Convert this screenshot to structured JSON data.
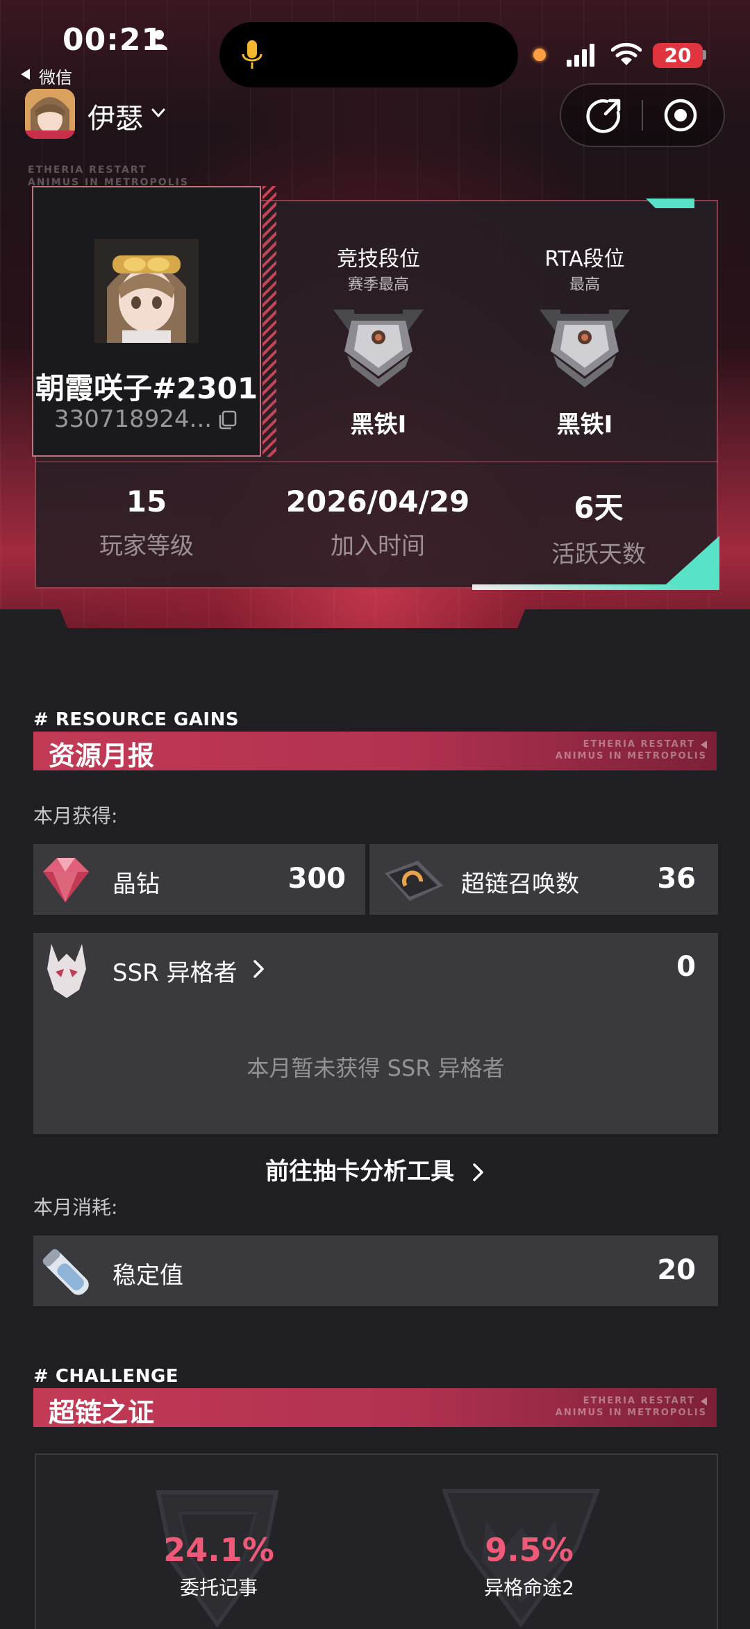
{
  "status_bar": {
    "time": "00:21",
    "battery": "20"
  },
  "nav": {
    "back_label": "微信",
    "app_name": "伊瑟"
  },
  "decor": {
    "etheria_line1": "ETHERIA RESTART",
    "etheria_line2": "ANIMUS IN METROPOLIS"
  },
  "profile": {
    "player_name": "朝霞咲子#2301",
    "uid": "330718924...",
    "ranks": [
      {
        "title": "竞技段位",
        "subtitle": "赛季最高",
        "rank": "黑铁I"
      },
      {
        "title": "RTA段位",
        "subtitle": "最高",
        "rank": "黑铁I"
      }
    ],
    "stats": [
      {
        "value": "15",
        "label": "玩家等级"
      },
      {
        "value": "2026/04/29",
        "label": "加入时间"
      },
      {
        "value": "6天",
        "label": "活跃天数"
      }
    ]
  },
  "resource": {
    "tag": "# RESOURCE GAINS",
    "title": "资源月报",
    "gained_label": "本月获得:",
    "items": [
      {
        "name": "晶钻",
        "value": "300"
      },
      {
        "name": "超链召唤数",
        "value": "36"
      }
    ],
    "ssr": {
      "name": "SSR 异格者",
      "value": "0",
      "empty_note": "本月暂未获得 SSR 异格者"
    },
    "gacha_link": "前往抽卡分析工具",
    "consumed_label": "本月消耗:",
    "consumed": {
      "name": "稳定值",
      "value": "20"
    }
  },
  "challenge": {
    "tag": "# CHALLENGE",
    "title": "超链之证",
    "items": [
      {
        "percent": "24.1%",
        "label": "委托记事"
      },
      {
        "percent": "9.5%",
        "label": "异格命途2"
      }
    ]
  },
  "colors": {
    "accent_red": "#c23a56",
    "accent_teal": "#58e3c8",
    "percent_pink": "#ef5a78"
  }
}
